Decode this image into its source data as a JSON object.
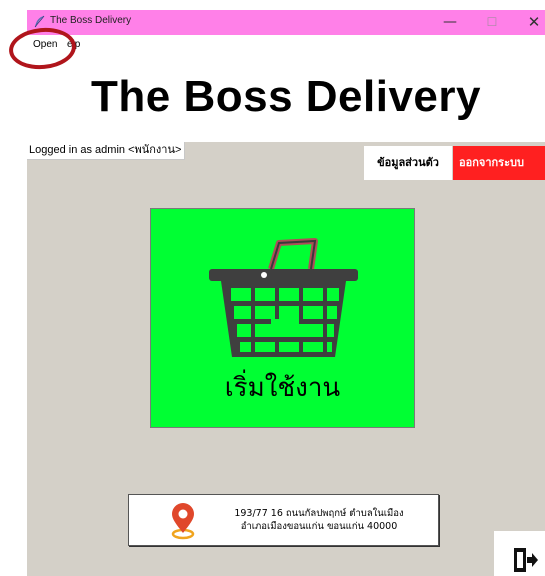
{
  "window": {
    "title": "The Boss Delivery",
    "minimize_glyph": "—",
    "maximize_glyph": "☐",
    "close_glyph": "✕"
  },
  "menu": {
    "open_label": "Open",
    "help_label": "elp"
  },
  "header": {
    "app_title": "The Boss Delivery"
  },
  "user": {
    "logged_in_text": "Logged in as admin <พนักงาน>"
  },
  "toolbar": {
    "profile_label": "ข้อมูลส่วนตัว",
    "exit_label": "ออกจากระบบ"
  },
  "start": {
    "label": "เริ่มใช้งาน",
    "icon": "shopping-basket-icon"
  },
  "address": {
    "line1": "193/77 16 ถนนกัลปพฤกษ์ ตำบลในเมือง",
    "line2": "อำเภอเมืองขอนแก่น ขอนแก่น 40000",
    "icon": "map-pin-icon"
  },
  "exit_door": {
    "icon": "door-exit-icon"
  },
  "colors": {
    "titlebar": "#ff80e8",
    "start_tile": "#00ff33",
    "exit_button": "#ff2020",
    "background": "#d4d0c8",
    "annotation": "#b0151b"
  }
}
